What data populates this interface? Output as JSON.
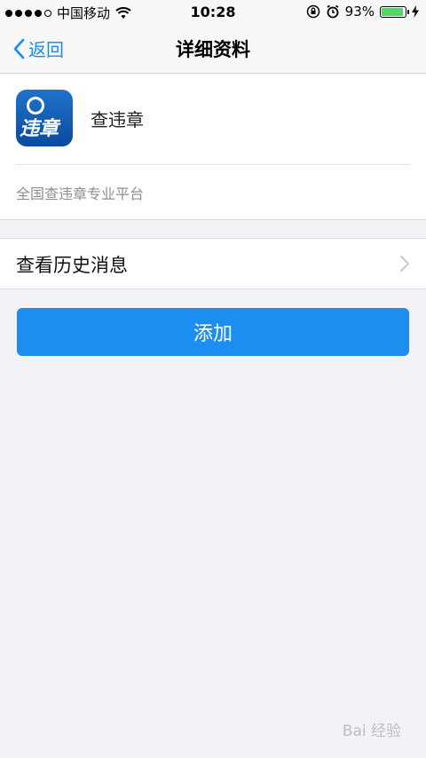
{
  "status_bar": {
    "carrier": "中国移动",
    "time": "10:28",
    "battery": "93%",
    "battery_level": 0.93
  },
  "nav": {
    "back_label": "返回",
    "title": "详细资料"
  },
  "profile": {
    "icon_text": "违章",
    "name": "查违章",
    "description": "全国查违章专业平台"
  },
  "history_row": {
    "label": "查看历史消息"
  },
  "add_button": {
    "label": "添加"
  },
  "watermark": "Bai 经验",
  "colors": {
    "accent": "#1b8ef0",
    "battery": "#4cd964",
    "background": "#f2f2f7"
  }
}
